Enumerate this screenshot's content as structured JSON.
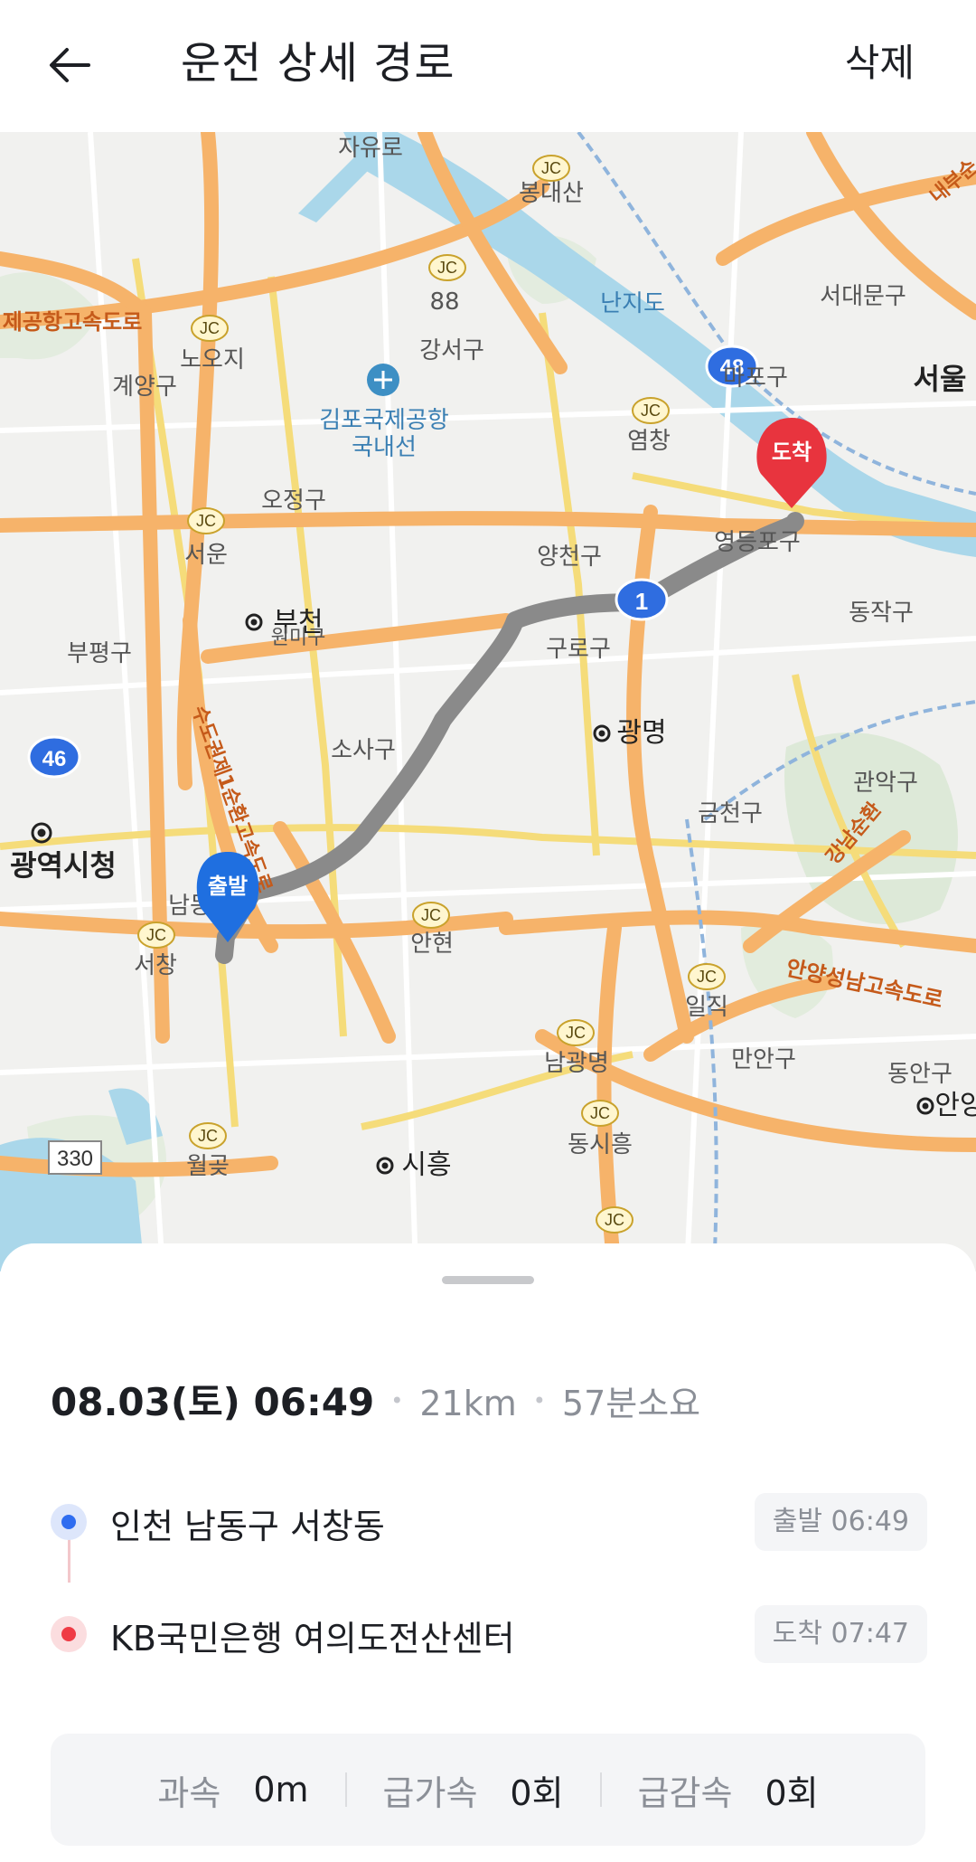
{
  "header": {
    "title": "운전 상세 경로",
    "delete_label": "삭제"
  },
  "map": {
    "start_badge": "출발",
    "end_badge": "도착",
    "route_color": "#8a8a8a",
    "start_color": "#1f6fe0",
    "end_color": "#e8343e",
    "labels": {
      "l1": "자유로",
      "l2": "봉대산",
      "l3": "88",
      "l4": "난지도",
      "l5": "서대문구",
      "l6": "제공항고속도로",
      "l7": "노오지",
      "l8": "계양구",
      "l9": "강서구",
      "l10": "김포국제공항",
      "l11": "국내선",
      "l12": "마포구",
      "l13": "서울",
      "l14": "염창",
      "l15": "오정구",
      "l16": "서운",
      "l17": "양천구",
      "l18": "영등포구",
      "l19": "1",
      "l20": "동작구",
      "l21": "부천",
      "l22": "원미구",
      "l23": "부평구",
      "l24": "구로구",
      "l25": "광명",
      "l26": "46",
      "l27": "소사구",
      "l28": "수도권제1순환고속도로",
      "l29": "관악구",
      "l30": "금천구",
      "l31": "광역시청",
      "l32": "남동",
      "l33": "안현",
      "l34": "서창",
      "l35": "일직",
      "l36": "안양성남고속도로",
      "l37": "강남순환",
      "l38": "남광명",
      "l39": "만안구",
      "l40": "동안구",
      "l41": "안양",
      "l42": "동시흥",
      "l43": "330",
      "l44": "월곶",
      "l45": "시흥",
      "l46": "내부순",
      "l47": "JC",
      "l48": "48"
    }
  },
  "trip": {
    "date_time": "08.03(토) 06:49",
    "distance": "21km",
    "duration": "57분소요",
    "separator": "•"
  },
  "stops": [
    {
      "name": "인천 남동구 서창동",
      "time_label": "출발 06:49"
    },
    {
      "name": "KB국민은행 여의도전산센터",
      "time_label": "도착 07:47"
    }
  ],
  "stats": [
    {
      "label": "과속",
      "value": "0m"
    },
    {
      "label": "급가속",
      "value": "0회"
    },
    {
      "label": "급감속",
      "value": "0회"
    }
  ]
}
